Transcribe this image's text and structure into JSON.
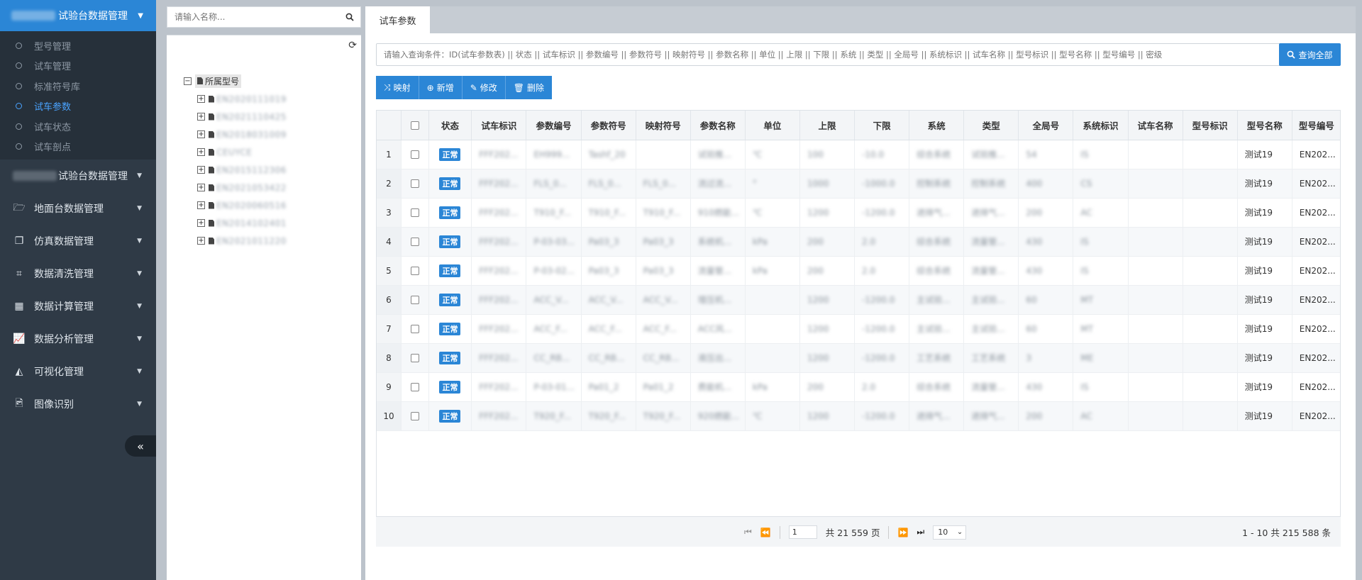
{
  "sidebar": {
    "header_title": "试验台数据管理",
    "sub_items": [
      {
        "label": "型号管理",
        "active": false
      },
      {
        "label": "试车管理",
        "active": false
      },
      {
        "label": "标准符号库",
        "active": false
      },
      {
        "label": "试车参数",
        "active": true
      },
      {
        "label": "试车状态",
        "active": false
      },
      {
        "label": "试车剖点",
        "active": false
      }
    ],
    "menu": [
      {
        "label": "试验台数据管理",
        "icon": "blurred-icon"
      },
      {
        "label": "地面台数据管理",
        "icon": "folder-open-icon"
      },
      {
        "label": "仿真数据管理",
        "icon": "copy-icon"
      },
      {
        "label": "数据清洗管理",
        "icon": "crop-icon"
      },
      {
        "label": "数据计算管理",
        "icon": "calculator-icon"
      },
      {
        "label": "数据分析管理",
        "icon": "line-chart-icon"
      },
      {
        "label": "可视化管理",
        "icon": "area-chart-icon"
      },
      {
        "label": "图像识别",
        "icon": "image-file-icon"
      }
    ],
    "collapse_glyph": "«"
  },
  "tree": {
    "search_placeholder": "请输入名称...",
    "root_label": "所属型号",
    "children": [
      "EN2020111019",
      "EN2021110425",
      "EN2018031009",
      "CEUYCE",
      "EN2015112306",
      "EN2021053422",
      "EN2020060516",
      "EN2014102401",
      "EN2021011220"
    ]
  },
  "main": {
    "tab_label": "试车参数",
    "query_placeholder": "请输入查询条件：ID(试车参数表) || 状态 || 试车标识 || 参数编号 || 参数符号 || 映射符号 || 参数名称 || 单位 || 上限 || 下限 || 系统 || 类型 || 全局号 || 系统标识 || 试车名称 || 型号标识 || 型号名称 || 型号编号 || 密级",
    "query_all_label": "查询全部",
    "toolbar": {
      "map": "映射",
      "add": "新增",
      "edit": "修改",
      "delete": "删除"
    },
    "columns": [
      "状态",
      "试车标识",
      "参数编号",
      "参数符号",
      "映射符号",
      "参数名称",
      "单位",
      "上限",
      "下限",
      "系统",
      "类型",
      "全局号",
      "系统标识",
      "试车名称",
      "型号标识",
      "型号名称",
      "型号编号"
    ],
    "rows": [
      {
        "n": "1",
        "status": "正常",
        "c": [
          "FFF202...",
          "EH999...",
          "Tashf_20",
          "",
          "试验推...",
          "℃",
          "100",
          "-10.0",
          "综合系统",
          "试验推...",
          "54",
          "IS",
          "",
          "",
          "测试19",
          "EN202..."
        ]
      },
      {
        "n": "2",
        "status": "正常",
        "c": [
          "FFF202...",
          "FLS_0...",
          "FLS_0...",
          "FLS_0...",
          "流过流...",
          "°",
          "1000",
          "-1000.0",
          "控制系统",
          "控制系统",
          "400",
          "CS",
          "",
          "",
          "测试19",
          "EN202..."
        ]
      },
      {
        "n": "3",
        "status": "正常",
        "c": [
          "FFF202...",
          "T910_F...",
          "T910_F...",
          "T910_F...",
          "910燃能...",
          "℃",
          "1200",
          "-1200.0",
          "进排气...",
          "进排气...",
          "200",
          "AC",
          "",
          "",
          "测试19",
          "EN202..."
        ]
      },
      {
        "n": "4",
        "status": "正常",
        "c": [
          "FFF202...",
          "P-03-03...",
          "Pa03_3",
          "Pa03_3",
          "系统机...",
          "kPa",
          "200",
          "2.0",
          "综合系统",
          "流量管...",
          "430",
          "IS",
          "",
          "",
          "测试19",
          "EN202..."
        ]
      },
      {
        "n": "5",
        "status": "正常",
        "c": [
          "FFF202...",
          "P-03-02...",
          "Pa03_3",
          "Pa03_3",
          "流量管...",
          "kPa",
          "200",
          "2.0",
          "综合系统",
          "流量管...",
          "430",
          "IS",
          "",
          "",
          "测试19",
          "EN202..."
        ]
      },
      {
        "n": "6",
        "status": "正常",
        "c": [
          "FFF202...",
          "ACC_V...",
          "ACC_V...",
          "ACC_V...",
          "增压机...",
          "",
          "1200",
          "-1200.0",
          "主试验...",
          "主试验...",
          "60",
          "MT",
          "",
          "",
          "测试19",
          "EN202..."
        ]
      },
      {
        "n": "7",
        "status": "正常",
        "c": [
          "FFF202...",
          "ACC_F...",
          "ACC_F...",
          "ACC_F...",
          "ACC风...",
          "",
          "1200",
          "-1200.0",
          "主试验...",
          "主试验...",
          "60",
          "MT",
          "",
          "",
          "测试19",
          "EN202..."
        ]
      },
      {
        "n": "8",
        "status": "正常",
        "c": [
          "FFF202...",
          "CC_RB...",
          "CC_RB...",
          "CC_RB...",
          "液压出...",
          "",
          "1200",
          "-1200.0",
          "工艺系统",
          "工艺系统",
          "3",
          "ME",
          "",
          "",
          "测试19",
          "EN202..."
        ]
      },
      {
        "n": "9",
        "status": "正常",
        "c": [
          "FFF202...",
          "P-03-01...",
          "Pa01_2",
          "Pa01_2",
          "费能机...",
          "kPa",
          "200",
          "2.0",
          "综合系统",
          "流量管...",
          "430",
          "IS",
          "",
          "",
          "测试19",
          "EN202..."
        ]
      },
      {
        "n": "10",
        "status": "正常",
        "c": [
          "FFF202...",
          "T920_F...",
          "T920_F...",
          "T920_F...",
          "920燃能...",
          "℃",
          "1200",
          "-1200.0",
          "进排气...",
          "进排气...",
          "200",
          "AC",
          "",
          "",
          "测试19",
          "EN202..."
        ]
      }
    ],
    "pager": {
      "page": "1",
      "total_pages_text": "共 21 559 页",
      "page_size": "10",
      "summary": "1 - 10 共 215 588 条"
    }
  }
}
